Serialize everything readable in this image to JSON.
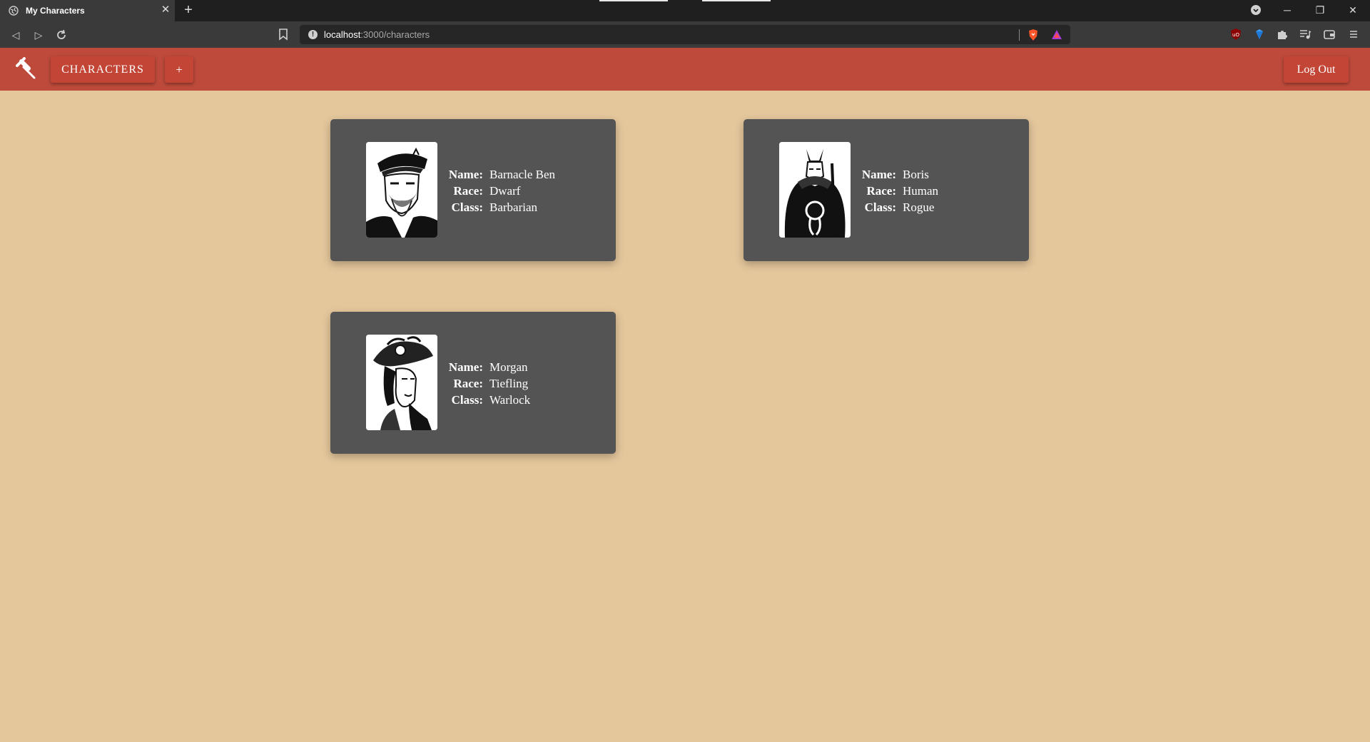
{
  "browser": {
    "tab_title": "My Characters",
    "new_tab_label": "+",
    "url_host": "localhost",
    "url_path": ":3000/characters"
  },
  "app": {
    "logo_icon": "hammer-icon",
    "characters_label": "CHARACTERS",
    "add_label": "+",
    "logout_label": "Log Out"
  },
  "labels": {
    "name": "Name:",
    "race": "Race:",
    "class": "Class:"
  },
  "characters": [
    {
      "name": "Barnacle Ben",
      "race": "Dwarf",
      "class": "Barbarian",
      "portrait_icon": "captain-portrait"
    },
    {
      "name": "Boris",
      "race": "Human",
      "class": "Rogue",
      "portrait_icon": "samurai-portrait"
    },
    {
      "name": "Morgan",
      "race": "Tiefling",
      "class": "Warlock",
      "portrait_icon": "hat-woman-portrait"
    }
  ],
  "colors": {
    "page_bg": "#e5c79c",
    "header_bg": "#bd4a3b",
    "button_bg": "#c24535",
    "card_bg": "#545454"
  }
}
